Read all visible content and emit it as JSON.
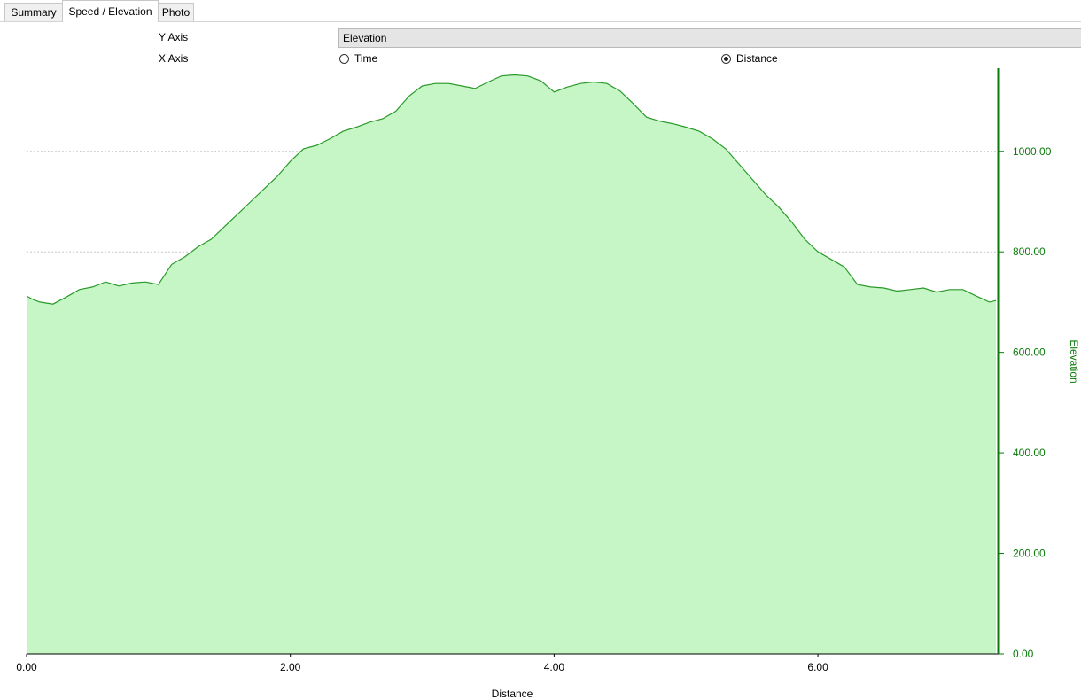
{
  "tabs": [
    {
      "label": "Summary",
      "active": false
    },
    {
      "label": "Speed / Elevation",
      "active": true
    },
    {
      "label": "Photo",
      "active": false
    }
  ],
  "controls": {
    "y_axis_label": "Y Axis",
    "y_axis_value": "Elevation",
    "x_axis_label": "X Axis",
    "x_options": [
      {
        "label": "Time",
        "selected": false
      },
      {
        "label": "Distance",
        "selected": true
      }
    ]
  },
  "colors": {
    "fill": "#c6f6c6",
    "line": "#2a9a2a",
    "axis": "#0a7a0a",
    "grid": "#c8c8c8"
  },
  "chart_data": {
    "type": "area",
    "title": "",
    "xlabel": "Distance",
    "ylabel": "Elevation",
    "xlim": [
      0,
      7.37
    ],
    "ylim": [
      0,
      1160
    ],
    "x_ticks": [
      "0.00",
      "2.00",
      "4.00",
      "6.00"
    ],
    "x_tick_values": [
      0,
      2,
      4,
      6
    ],
    "y_ticks": [
      "0.00",
      "200.00",
      "400.00",
      "600.00",
      "800.00",
      "1000.00"
    ],
    "y_tick_values": [
      0,
      200,
      400,
      600,
      800,
      1000
    ],
    "y_axis_side": "right",
    "grid": true,
    "series": [
      {
        "x": [
          0.0,
          0.05,
          0.1,
          0.2,
          0.3,
          0.4,
          0.5,
          0.6,
          0.7,
          0.8,
          0.9,
          1.0,
          1.1,
          1.2,
          1.3,
          1.4,
          1.5,
          1.6,
          1.7,
          1.8,
          1.9,
          2.0,
          2.1,
          2.2,
          2.3,
          2.4,
          2.5,
          2.6,
          2.7,
          2.8,
          2.9,
          3.0,
          3.1,
          3.2,
          3.3,
          3.4,
          3.5,
          3.6,
          3.7,
          3.8,
          3.9,
          4.0,
          4.1,
          4.2,
          4.3,
          4.4,
          4.5,
          4.6,
          4.7,
          4.8,
          4.9,
          5.0,
          5.1,
          5.2,
          5.3,
          5.4,
          5.5,
          5.6,
          5.7,
          5.8,
          5.9,
          6.0,
          6.1,
          6.2,
          6.3,
          6.4,
          6.5,
          6.6,
          6.7,
          6.8,
          6.9,
          7.0,
          7.1,
          7.2,
          7.3,
          7.35
        ],
        "y": [
          712,
          705,
          700,
          696,
          710,
          725,
          730,
          740,
          732,
          738,
          740,
          735,
          775,
          790,
          810,
          825,
          850,
          875,
          900,
          925,
          950,
          980,
          1005,
          1012,
          1025,
          1040,
          1048,
          1058,
          1065,
          1080,
          1110,
          1130,
          1135,
          1135,
          1130,
          1125,
          1138,
          1150,
          1152,
          1150,
          1140,
          1118,
          1128,
          1135,
          1138,
          1135,
          1120,
          1095,
          1068,
          1060,
          1055,
          1048,
          1040,
          1025,
          1005,
          975,
          945,
          915,
          890,
          860,
          825,
          800,
          785,
          770,
          735,
          730,
          728,
          722,
          725,
          728,
          720,
          725,
          725,
          712,
          700,
          703
        ]
      }
    ]
  }
}
